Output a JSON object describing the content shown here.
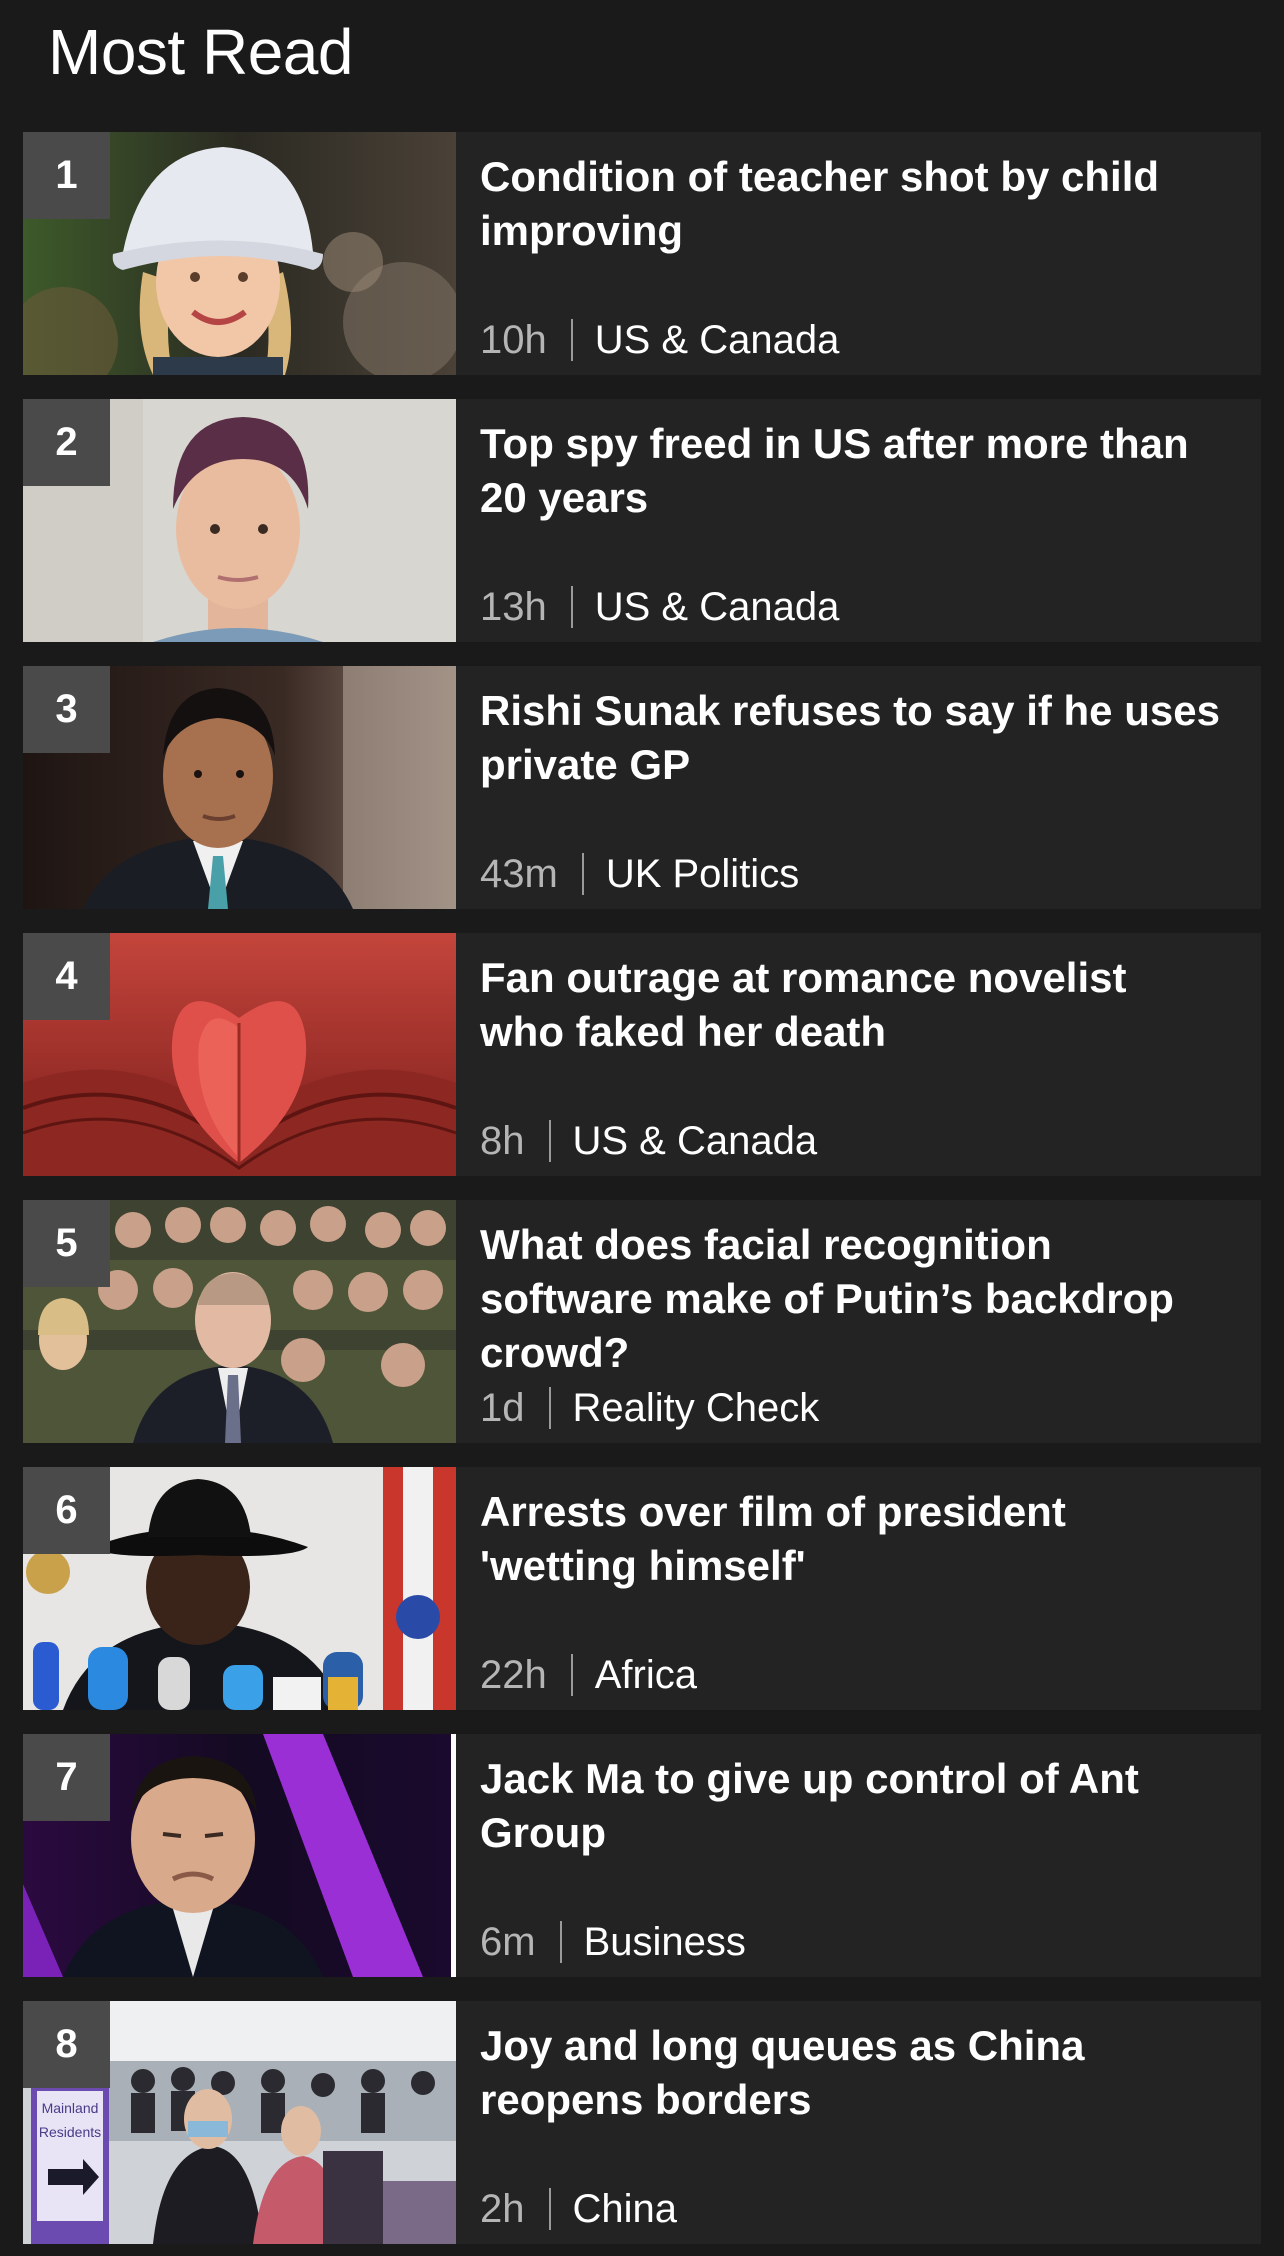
{
  "section": {
    "title": "Most Read"
  },
  "stories": [
    {
      "rank": "1",
      "headline": "Condition of teacher shot by child improving",
      "time": "10h",
      "topic": "US & Canada",
      "image": "woman-white-bucket-hat"
    },
    {
      "rank": "2",
      "headline": "Top spy freed in US after more than 20 years",
      "time": "13h",
      "topic": "US & Canada",
      "image": "woman-short-hair-portrait"
    },
    {
      "rank": "3",
      "headline": "Rishi Sunak refuses to say if he uses private GP",
      "time": "43m",
      "topic": "UK Politics",
      "image": "man-in-suit-portrait"
    },
    {
      "rank": "4",
      "headline": "Fan outrage at romance novelist who faked her death",
      "time": "8h",
      "topic": "US & Canada",
      "image": "book-pages-heart"
    },
    {
      "rank": "5",
      "headline": "What does facial recognition software make of Putin’s backdrop crowd?",
      "time": "1d",
      "topic": "Reality Check",
      "image": "crowd-in-uniform"
    },
    {
      "rank": "6",
      "headline": "Arrests over film of president 'wetting himself'",
      "time": "22h",
      "topic": "Africa",
      "image": "man-black-hat-microphones"
    },
    {
      "rank": "7",
      "headline": "Jack Ma to give up control of Ant Group",
      "time": "6m",
      "topic": "Business",
      "image": "man-purple-background"
    },
    {
      "rank": "8",
      "headline": "Joy and long queues as China reopens borders",
      "time": "2h",
      "topic": "China",
      "image": "airport-crowd",
      "sign_lines": [
        "Mainland",
        "Residents"
      ]
    }
  ],
  "colors": {
    "background": "#1a1a1a",
    "card": "#232323",
    "rank_badge": "#4a4a4a",
    "meta_time": "#b5b5b5"
  }
}
